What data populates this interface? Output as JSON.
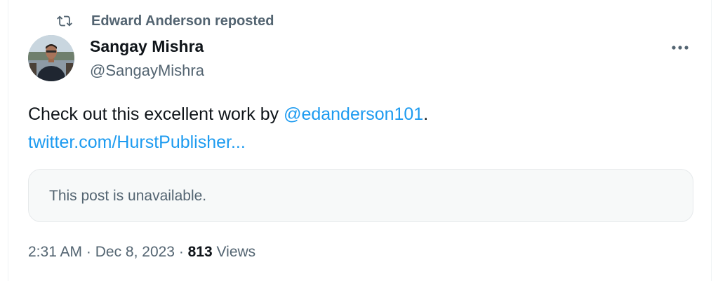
{
  "repost": {
    "label": "Edward Anderson reposted",
    "icon": "repost-icon"
  },
  "author": {
    "display_name": "Sangay Mishra",
    "handle": "@SangayMishra",
    "avatar": "avatar"
  },
  "more_menu": {
    "icon": "more-horizontal-icon"
  },
  "tweet": {
    "text_before_mention": "Check out this excellent work by ",
    "mention": "@edanderson101",
    "text_after_mention": ".",
    "link": "twitter.com/HurstPublisher..."
  },
  "quoted_post": {
    "message": "This post is unavailable."
  },
  "meta": {
    "time": "2:31 AM",
    "separator": " · ",
    "date": "Dec 8, 2023",
    "views_count": "813",
    "views_label": "Views"
  },
  "colors": {
    "link": "#1d9bf0",
    "secondary_text": "#536471",
    "primary_text": "#0f1419",
    "card_background": "#f7f9f9",
    "border": "#eff3f4"
  }
}
